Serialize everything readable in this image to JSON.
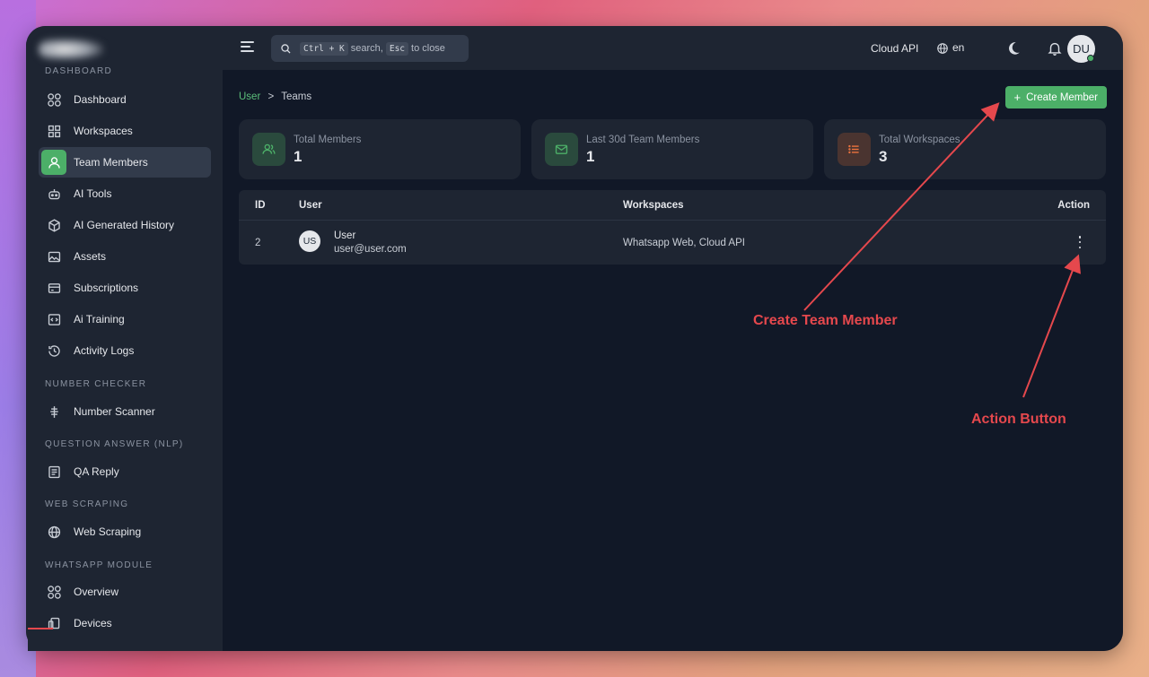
{
  "sidebar": {
    "section_dashboard": "DASHBOARD",
    "items_main": [
      {
        "label": "Dashboard",
        "icon": "dashboard-icon"
      },
      {
        "label": "Workspaces",
        "icon": "grid-icon"
      },
      {
        "label": "Team Members",
        "icon": "user-icon",
        "active": true
      },
      {
        "label": "AI Tools",
        "icon": "robot-icon"
      },
      {
        "label": "AI Generated History",
        "icon": "cube-icon"
      },
      {
        "label": "Assets",
        "icon": "image-icon"
      },
      {
        "label": "Subscriptions",
        "icon": "card-icon"
      },
      {
        "label": "Ai Training",
        "icon": "code-icon"
      },
      {
        "label": "Activity Logs",
        "icon": "history-icon"
      }
    ],
    "section_number": "NUMBER CHECKER",
    "number_scanner": "Number Scanner",
    "section_qa": "QUESTION ANSWER (NLP)",
    "qa_reply": "QA Reply",
    "section_scraping": "WEB SCRAPING",
    "web_scraping": "Web Scraping",
    "section_whatsapp": "WHATSAPP MODULE",
    "overview": "Overview",
    "devices": "Devices"
  },
  "topbar": {
    "search_key1": "Ctrl + K",
    "search_mid": "search,",
    "search_key2": "Esc",
    "search_end": "to close",
    "cloud_api": "Cloud API",
    "language": "en",
    "avatar": "DU"
  },
  "breadcrumb": {
    "home": "User",
    "sep": ">",
    "current": "Teams"
  },
  "create_button": "Create Member",
  "stats": [
    {
      "title": "Total Members",
      "value": "1",
      "color": "#4caf68"
    },
    {
      "title": "Last 30d Team Members",
      "value": "1",
      "color": "#4caf68"
    },
    {
      "title": "Total Workspaces",
      "value": "3",
      "color": "#f0743e"
    }
  ],
  "table": {
    "headers": [
      "ID",
      "User",
      "Workspaces",
      "Action"
    ],
    "rows": [
      {
        "id": "2",
        "avatar": "US",
        "name": "User",
        "email": "user@user.com",
        "workspaces": "Whatsapp Web, Cloud API"
      }
    ]
  },
  "annotations": {
    "create": "Create Team Member",
    "action": "Action Button"
  },
  "colors": {
    "accent": "#4caf68",
    "annotation": "#e5484d",
    "background": "#111827",
    "panel": "#1e2532"
  }
}
